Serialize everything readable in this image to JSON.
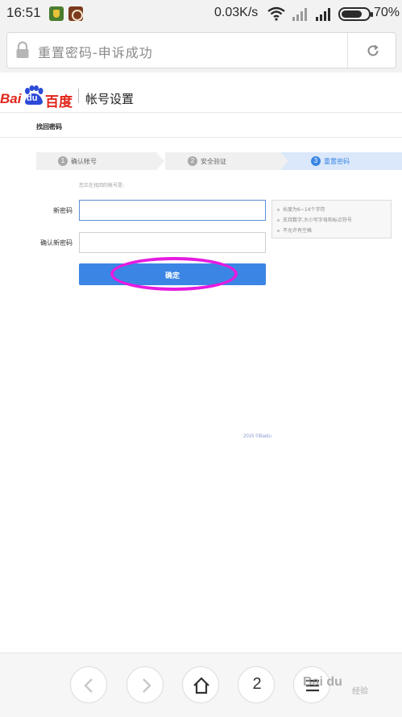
{
  "status_bar": {
    "time": "16:51",
    "net_speed": "0.03K/s",
    "battery": "70%",
    "icons": [
      "notification-shield-icon",
      "notification-app-icon",
      "wifi-icon",
      "signal-icon",
      "signal-icon",
      "battery-icon"
    ]
  },
  "browser": {
    "page_title": "重置密码-申诉成功",
    "icons": [
      "lock-icon",
      "refresh-icon"
    ]
  },
  "header": {
    "logo_text_latin": "Bai",
    "logo_text_du": "du",
    "logo_text_cn": "百度",
    "title": "帐号设置"
  },
  "page": {
    "subtitle": "找回密码",
    "steps": [
      {
        "number": "1",
        "label": "确认帐号",
        "active": false
      },
      {
        "number": "2",
        "label": "安全验证",
        "active": false
      },
      {
        "number": "3",
        "label": "重置密码",
        "active": true
      }
    ],
    "hint": "您正在找回的帐号是:",
    "new_password_label": "新密码",
    "new_password_value": "",
    "confirm_password_label": "确认新密码",
    "confirm_password_value": "",
    "rules": [
      "长度为6~14个字符",
      "支持数字,大小写字母和标点符号",
      "不允许有空格"
    ],
    "submit_label": "确定",
    "highlight_color": "#e61be0",
    "accent_color": "#3b86e4",
    "copyright": "2015 ©Baidu"
  },
  "toolbar": {
    "back_icon": "chevron-left-icon",
    "forward_icon": "chevron-right-icon",
    "home_icon": "home-icon",
    "tab_count": "2",
    "menu_icon": "menu-icon"
  },
  "watermark": {
    "text": "Bai du",
    "sub": "经验"
  }
}
